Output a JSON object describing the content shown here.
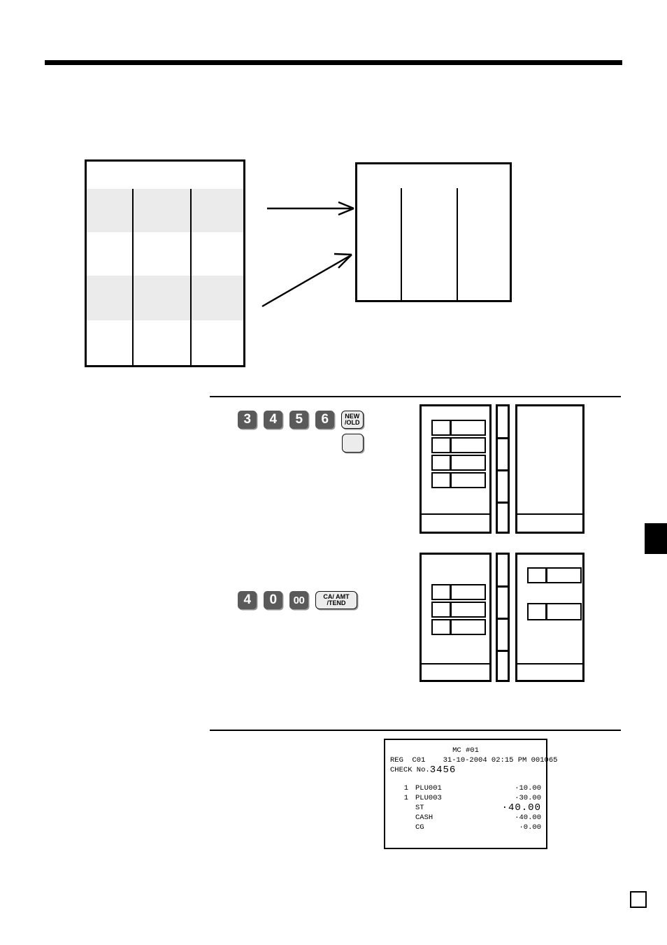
{
  "page": {
    "page_number": ""
  },
  "diagram": {
    "source_table": {
      "name": "source-check-table",
      "columns": 3,
      "rows": 5,
      "shaded_rows": [
        2,
        4
      ]
    },
    "destination_table": {
      "name": "destination-check-table",
      "columns": 3
    },
    "arrows": [
      {
        "name": "transfer-arrow-upper",
        "label": ""
      },
      {
        "name": "transfer-arrow-lower",
        "label": ""
      }
    ]
  },
  "operation_1": {
    "keys": [
      {
        "label": "3",
        "type": "numeric"
      },
      {
        "label": "4",
        "type": "numeric"
      },
      {
        "label": "5",
        "type": "numeric"
      },
      {
        "label": "6",
        "type": "numeric"
      }
    ],
    "function_key": {
      "line1": "NEW",
      "line2": "/OLD"
    },
    "blank_key": {
      "label": ""
    },
    "display": {
      "left_panel_rows": 4,
      "strip_segments": 4,
      "right_panel_rows": 0
    }
  },
  "operation_2": {
    "keys": [
      {
        "label": "4",
        "type": "numeric"
      },
      {
        "label": "0",
        "type": "numeric"
      },
      {
        "label": "00",
        "type": "numeric"
      }
    ],
    "function_key": {
      "line1": "CA/ AMT",
      "line2": "/TEND",
      "part1": "CA",
      "part2": "AMT",
      "part3": "TEND"
    },
    "display": {
      "left_panel_rows": 3,
      "strip_segments": 4,
      "right_panel_rows": 2
    }
  },
  "receipt": {
    "header_mc": "MC #01",
    "line_reg": "REG  C01    31-10-2004 02:15 PM 001065",
    "check_label": "CHECK No.",
    "check_number": "3456",
    "items": [
      {
        "qty": "1",
        "name": "PLU001",
        "amount": "·10.00",
        "emphasis": false
      },
      {
        "qty": "1",
        "name": "PLU003",
        "amount": "·30.00",
        "emphasis": false
      },
      {
        "qty": "",
        "name": "ST",
        "amount": "·40.00",
        "emphasis": true
      },
      {
        "qty": "",
        "name": "CASH",
        "amount": "·40.00",
        "emphasis": false
      },
      {
        "qty": "",
        "name": "CG",
        "amount": "·0.00",
        "emphasis": false
      }
    ]
  },
  "colors": {
    "ink": "#000000",
    "key_fill": "#5a5a5a",
    "key_text": "#ffffff",
    "shade": "#ebebeb"
  }
}
